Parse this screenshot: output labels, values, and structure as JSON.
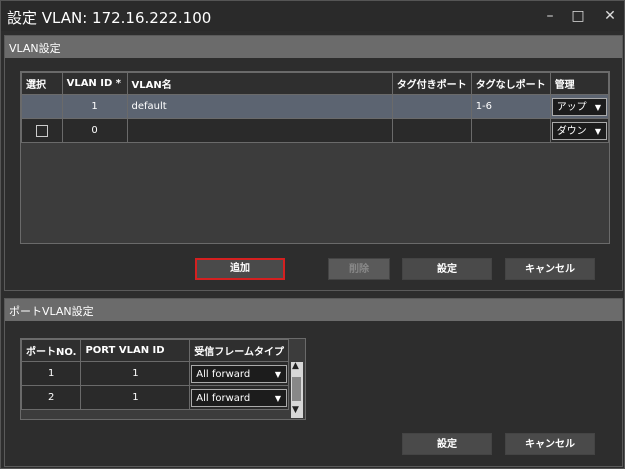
{
  "window": {
    "title": "設定 VLAN: 172.16.222.100",
    "minimize_icon": "minimize-icon",
    "maximize_icon": "maximize-icon",
    "close_icon": "close-icon"
  },
  "vlan": {
    "heading": "VLAN設定",
    "columns": [
      "選択",
      "VLAN ID *",
      "VLAN名",
      "タグ付きポート",
      "タグなしポート",
      "管理"
    ],
    "rows": [
      {
        "select": "",
        "id": "1",
        "name": "default",
        "tagged": "",
        "untagged": "1-6",
        "admin": "アップ",
        "selected": true
      },
      {
        "select": "checkbox",
        "id": "0",
        "name": "",
        "tagged": "",
        "untagged": "",
        "admin": "ダウン",
        "selected": false
      }
    ],
    "buttons": {
      "add": "追加",
      "delete": "削除",
      "set": "設定",
      "cancel": "キャンセル"
    }
  },
  "port_vlan": {
    "heading": "ポートVLAN設定",
    "columns": [
      "ポートNO.",
      "PORT VLAN ID",
      "受信フレームタイプ"
    ],
    "rows": [
      {
        "port": "1",
        "pvid": "1",
        "frame_type": "All forward"
      },
      {
        "port": "2",
        "pvid": "1",
        "frame_type": "All forward"
      }
    ],
    "buttons": {
      "set": "設定",
      "cancel": "キャンセル"
    }
  },
  "colors": {
    "accent_border": "#d42020",
    "section_header": "#6b6b6b",
    "selected_row": "#5c6471"
  }
}
